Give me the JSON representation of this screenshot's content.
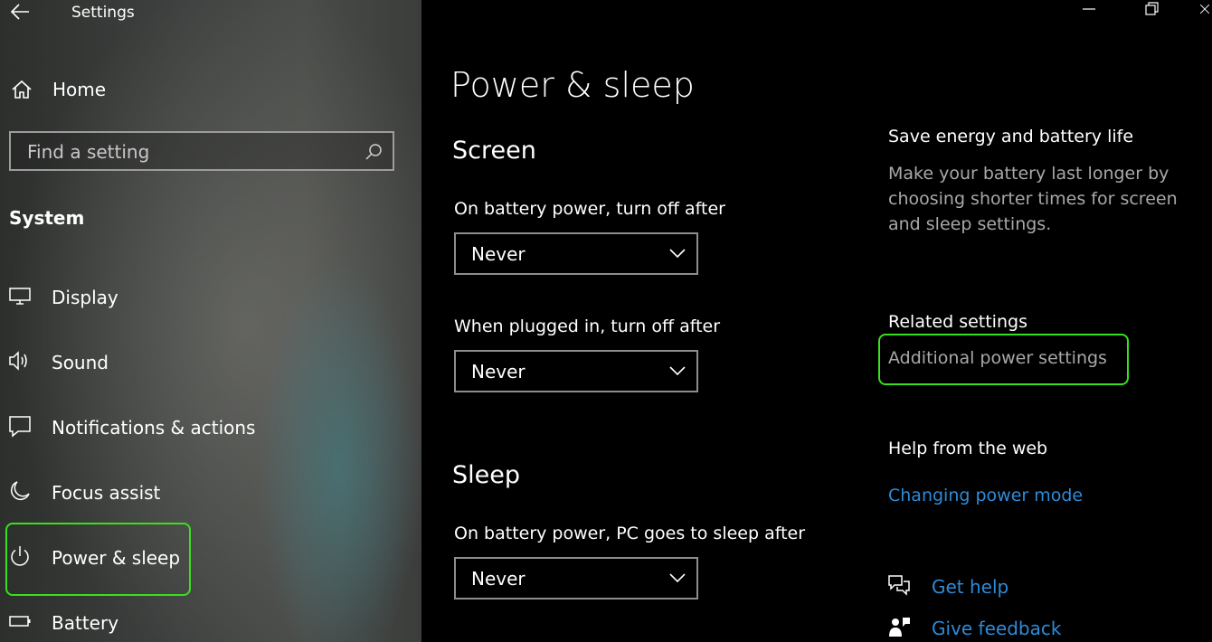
{
  "window": {
    "title": "Settings"
  },
  "sidebar": {
    "home_label": "Home",
    "search_placeholder": "Find a setting",
    "section_title": "System",
    "items": [
      {
        "label": "Display",
        "icon": "display-icon"
      },
      {
        "label": "Sound",
        "icon": "speaker-icon"
      },
      {
        "label": "Notifications & actions",
        "icon": "notification-icon"
      },
      {
        "label": "Focus assist",
        "icon": "moon-icon"
      },
      {
        "label": "Power & sleep",
        "icon": "power-icon",
        "selected": true
      },
      {
        "label": "Battery",
        "icon": "battery-icon"
      }
    ]
  },
  "main": {
    "page_title": "Power & sleep",
    "screen": {
      "title": "Screen",
      "battery_label": "On battery power, turn off after",
      "battery_value": "Never",
      "plugged_label": "When plugged in, turn off after",
      "plugged_value": "Never"
    },
    "sleep": {
      "title": "Sleep",
      "battery_label": "On battery power, PC goes to sleep after",
      "battery_value": "Never"
    }
  },
  "right": {
    "save_title": "Save energy and battery life",
    "save_desc": "Make your battery last longer by choosing shorter times for screen and sleep settings.",
    "related_title": "Related settings",
    "related_link": "Additional power settings",
    "help_title": "Help from the web",
    "help_link": "Changing power mode",
    "get_help": "Get help",
    "give_feedback": "Give feedback"
  },
  "colors": {
    "highlight": "#3adf1e",
    "link": "#2e8bd8",
    "background": "#000000"
  }
}
